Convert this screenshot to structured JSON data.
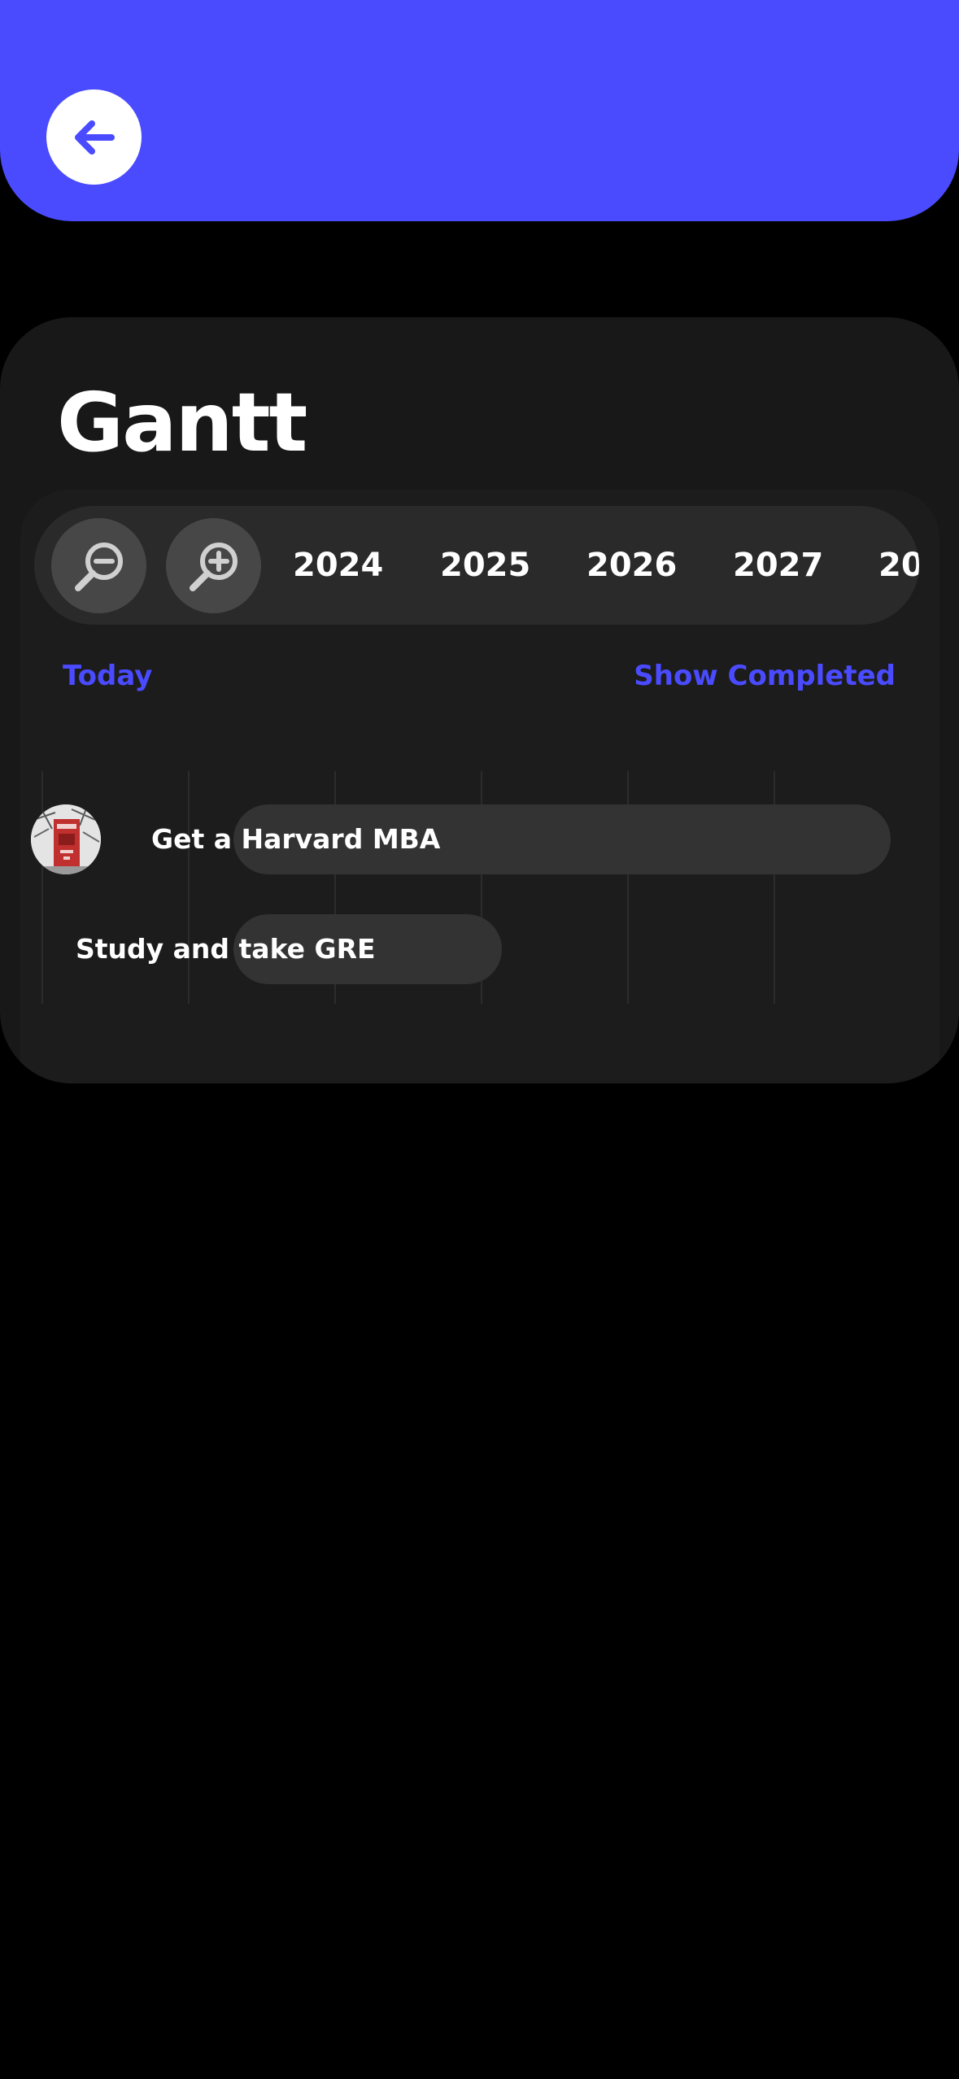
{
  "header": {
    "back_icon": "arrow-left-icon",
    "background_color": "#4a4bff"
  },
  "gantt": {
    "title": "Gantt",
    "toolbar": {
      "zoom_out_icon": "zoom-out-icon",
      "zoom_in_icon": "zoom-in-icon",
      "years": [
        "2024",
        "2025",
        "2026",
        "2027",
        "20"
      ]
    },
    "links": {
      "today": "Today",
      "show_completed": "Show Completed"
    },
    "tasks": [
      {
        "label": "Get a Harvard MBA",
        "has_avatar": true,
        "avatar_icon": "harvard-sign-photo"
      },
      {
        "label": "Study and take GRE",
        "has_avatar": false
      }
    ]
  },
  "colors": {
    "accent": "#4a4bff",
    "background": "#000000",
    "card": "#181818",
    "toolbar": "#2a2a2a",
    "bar": "#333333"
  }
}
